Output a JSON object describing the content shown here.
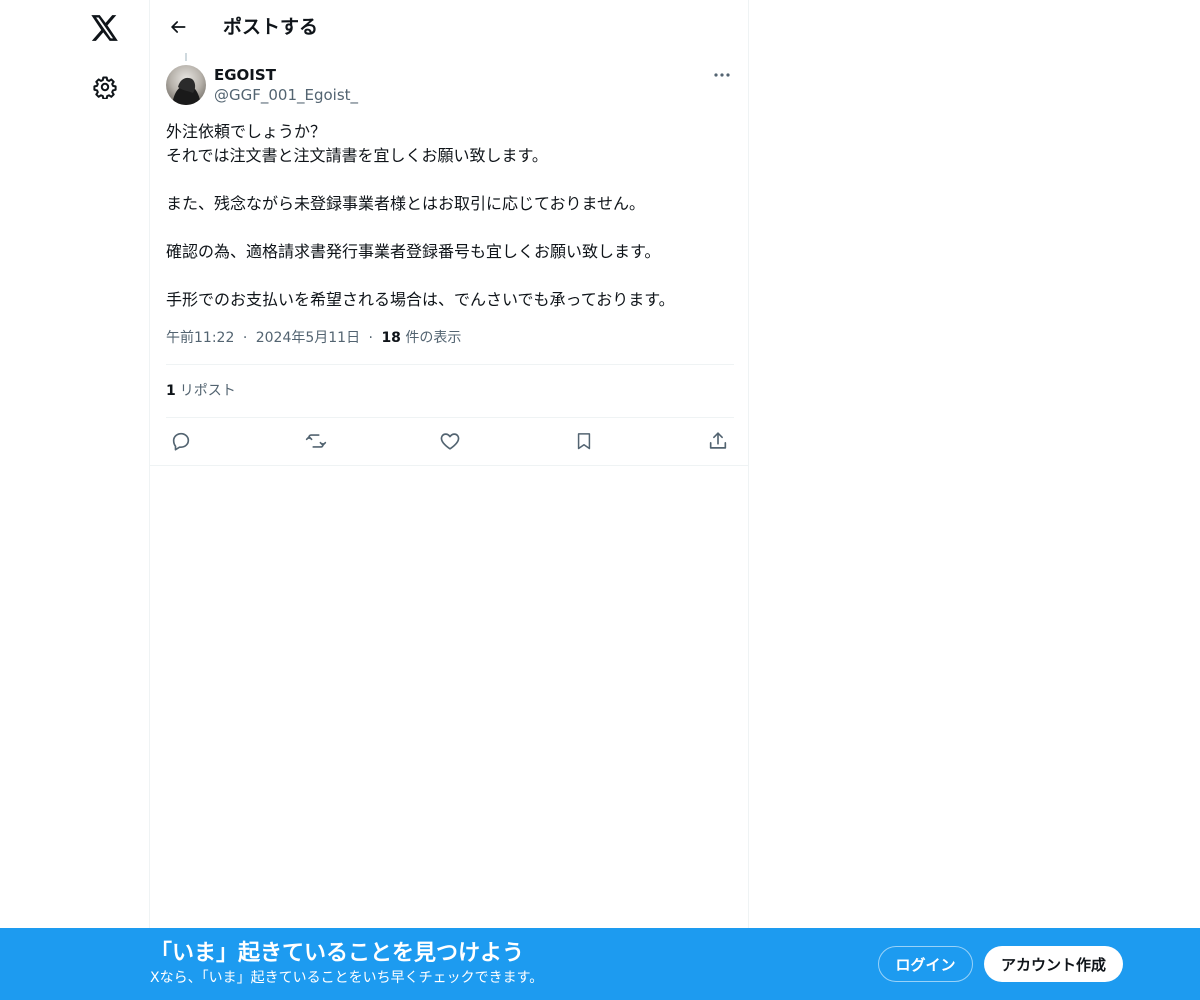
{
  "nav": {
    "logo_icon": "x-logo-icon",
    "settings_icon": "gear-icon"
  },
  "header": {
    "title": "ポストする",
    "back_icon": "arrow-left-icon"
  },
  "post": {
    "author": {
      "name": "EGOIST",
      "handle": "@GGF_001_Egoist_"
    },
    "text_lines": [
      "外注依頼でしょうか？",
      "それでは注文書と注文請書を宜しくお願い致します。",
      "",
      "また、残念ながら未登録事業者様とはお取引に応じておりません。",
      "",
      "確認の為、適格請求書発行事業者登録番号も宜しくお願い致します。",
      "",
      "手形でのお支払いを希望される場合は、でんさいでも承っております。"
    ],
    "meta": {
      "time": "午前11:22",
      "date": "2024年5月11日",
      "separator": "·",
      "views_count": "18",
      "views_label": "件の表示"
    },
    "stats": {
      "reposts_count": "1",
      "reposts_label": "リポスト"
    },
    "actions": [
      {
        "name": "reply",
        "icon": "reply-icon"
      },
      {
        "name": "repost",
        "icon": "repost-icon"
      },
      {
        "name": "like",
        "icon": "heart-icon"
      },
      {
        "name": "bookmark",
        "icon": "bookmark-icon"
      },
      {
        "name": "share",
        "icon": "share-icon"
      }
    ]
  },
  "banner": {
    "title": "「いま」起きていることを見つけよう",
    "subtitle": "Xなら、「いま」起きていることをいち早くチェックできます。",
    "login_label": "ログイン",
    "signup_label": "アカウント作成"
  },
  "colors": {
    "accent": "#1d9bf0",
    "text_primary": "#0f1419",
    "text_secondary": "#536471",
    "border": "#eff3f4"
  }
}
